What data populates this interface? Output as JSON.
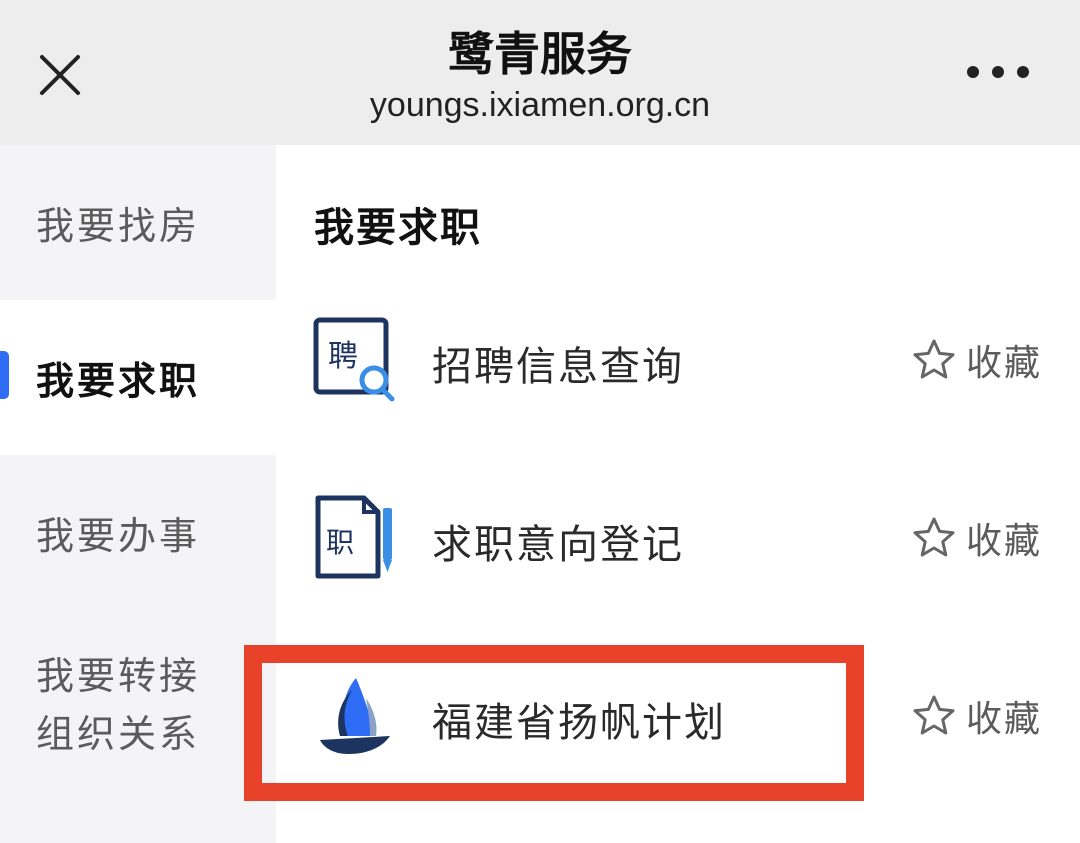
{
  "header": {
    "title": "鹭青服务",
    "url": "youngs.ixiamen.org.cn",
    "close_icon": "close-icon",
    "more_icon": "more-dots-icon"
  },
  "sidebar": {
    "items": [
      {
        "label": "我要找房"
      },
      {
        "label": "我要求职",
        "active": true
      },
      {
        "label": "我要办事"
      },
      {
        "label_line1": "我要转接",
        "label_line2": "组织关系"
      }
    ],
    "accent_color": "#2f6cf5"
  },
  "main": {
    "section_title": "我要求职",
    "items": [
      {
        "label": "招聘信息查询",
        "icon": "recruit-search-icon",
        "icon_text": "聘",
        "fav_label": "收藏",
        "fav_icon": "star-icon"
      },
      {
        "label": "求职意向登记",
        "icon": "job-register-icon",
        "icon_text": "职",
        "fav_label": "收藏",
        "fav_icon": "star-icon"
      },
      {
        "label": "福建省扬帆计划",
        "icon": "sailboat-icon",
        "fav_label": "收藏",
        "fav_icon": "star-icon",
        "highlighted": true
      }
    ]
  },
  "colors": {
    "header_bg": "#ededed",
    "sidebar_bg": "#f4f4f6",
    "highlight_border": "#e8422b",
    "icon_navy": "#1d3460",
    "icon_blue": "#3a8ee6"
  }
}
